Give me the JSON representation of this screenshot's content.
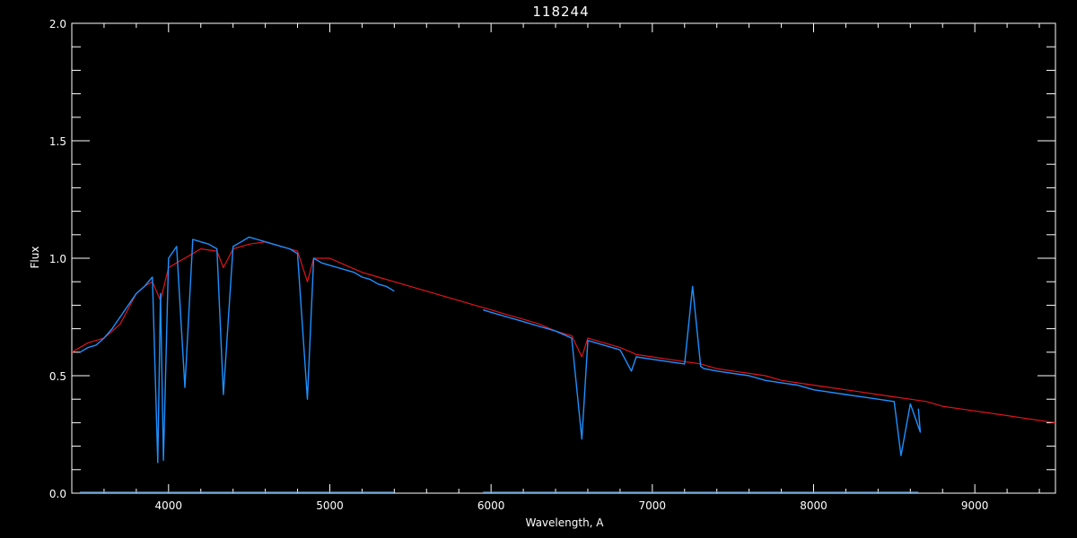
{
  "chart_data": {
    "type": "line",
    "title": "118244",
    "xlabel": "Wavelength, A",
    "ylabel": "Flux",
    "xlim": [
      3400,
      9500
    ],
    "ylim": [
      0,
      2.0
    ],
    "x_ticks": [
      4000,
      5000,
      6000,
      7000,
      8000,
      9000
    ],
    "x_tick_labels": [
      "4000",
      "5000",
      "6000",
      "7000",
      "8000",
      "9000"
    ],
    "y_ticks": [
      0.0,
      0.5,
      1.0,
      1.5,
      2.0
    ],
    "y_tick_labels": [
      "0.0",
      "0.5",
      "1.0",
      "1.5",
      "2.0"
    ],
    "grid": false,
    "colors": {
      "background": "#000000",
      "axes": "#ffffff",
      "model": "#e0141e",
      "observed": "#1e90ff",
      "observed_alt": "#ffffff"
    },
    "series": [
      {
        "color": "#e0141e",
        "x": [
          3400,
          3500,
          3600,
          3700,
          3800,
          3850,
          3900,
          3950,
          4000,
          4050,
          4100,
          4150,
          4200,
          4300,
          4340,
          4400,
          4500,
          4600,
          4700,
          4800,
          4861,
          4900,
          5000,
          5100,
          5200,
          5300,
          5400,
          5500,
          5600,
          5700,
          5800,
          5900,
          6000,
          6100,
          6200,
          6300,
          6400,
          6500,
          6563,
          6600,
          6700,
          6800,
          6870,
          6900,
          7000,
          7100,
          7200,
          7300,
          7400,
          7500,
          7600,
          7700,
          7800,
          7900,
          8000,
          8100,
          8200,
          8300,
          8400,
          8500,
          8600,
          8700,
          8800,
          8900,
          9000,
          9100,
          9200,
          9300,
          9400,
          9500
        ],
        "y": [
          0.6,
          0.64,
          0.66,
          0.72,
          0.85,
          0.88,
          0.9,
          0.82,
          0.96,
          0.98,
          1.0,
          1.02,
          1.04,
          1.03,
          0.96,
          1.04,
          1.06,
          1.07,
          1.05,
          1.03,
          0.9,
          1.0,
          1.0,
          0.97,
          0.94,
          0.92,
          0.9,
          0.88,
          0.86,
          0.84,
          0.82,
          0.8,
          0.78,
          0.76,
          0.74,
          0.72,
          0.69,
          0.67,
          0.58,
          0.66,
          0.64,
          0.62,
          0.6,
          0.59,
          0.58,
          0.57,
          0.56,
          0.55,
          0.53,
          0.52,
          0.51,
          0.5,
          0.48,
          0.47,
          0.46,
          0.45,
          0.44,
          0.43,
          0.42,
          0.41,
          0.4,
          0.39,
          0.37,
          0.36,
          0.35,
          0.34,
          0.33,
          0.32,
          0.31,
          0.3
        ]
      },
      {
        "color": "#1e90ff",
        "x": [
          3450,
          3500,
          3550,
          3600,
          3650,
          3700,
          3750,
          3800,
          3850,
          3900,
          3933,
          3950,
          3968,
          4000,
          4050,
          4101,
          4150,
          4200,
          4250,
          4300,
          4340,
          4400,
          4450,
          4500,
          4550,
          4600,
          4650,
          4700,
          4750,
          4800,
          4861,
          4900,
          4950,
          5000,
          5050,
          5100,
          5150,
          5200,
          5250,
          5300,
          5350,
          5400
        ],
        "y": [
          0.6,
          0.62,
          0.63,
          0.66,
          0.7,
          0.75,
          0.8,
          0.85,
          0.88,
          0.92,
          0.13,
          0.85,
          0.14,
          1.0,
          1.05,
          0.45,
          1.08,
          1.07,
          1.06,
          1.04,
          0.42,
          1.05,
          1.07,
          1.09,
          1.08,
          1.07,
          1.06,
          1.05,
          1.04,
          1.02,
          0.4,
          1.0,
          0.98,
          0.97,
          0.96,
          0.95,
          0.94,
          0.92,
          0.91,
          0.89,
          0.88,
          0.86
        ]
      },
      {
        "color": "#1e90ff",
        "x": [
          5950,
          6000,
          6100,
          6200,
          6300,
          6400,
          6500,
          6563,
          6600,
          6700,
          6800,
          6870,
          6900,
          7000,
          7100,
          7200,
          7250,
          7300,
          7320,
          7400,
          7500,
          7600,
          7700,
          7800,
          7900,
          8000,
          8100,
          8200,
          8300,
          8400,
          8500,
          8542,
          8600,
          8662,
          8650
        ],
        "y": [
          0.78,
          0.77,
          0.75,
          0.73,
          0.71,
          0.69,
          0.66,
          0.23,
          0.65,
          0.63,
          0.61,
          0.52,
          0.58,
          0.57,
          0.56,
          0.55,
          0.88,
          0.54,
          0.53,
          0.52,
          0.51,
          0.5,
          0.48,
          0.47,
          0.46,
          0.44,
          0.43,
          0.42,
          0.41,
          0.4,
          0.39,
          0.16,
          0.38,
          0.26,
          0.36
        ]
      }
    ]
  }
}
